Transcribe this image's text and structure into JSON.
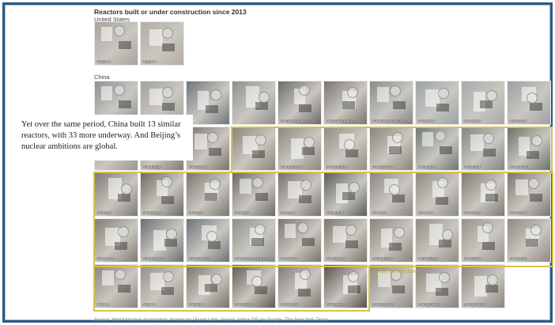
{
  "title": "Reactors built or under construction since 2013",
  "countries": {
    "us": "United States",
    "china": "China"
  },
  "callout": "Yet over the same period, China built 13 similar reactors, with 33 more underway. And Beijing’s nuclear ambitions are global.",
  "under_construction_label": "Under construction",
  "source": "Source: World Nuclear Association. Images by Planet Labs, Vexcel, Airbus DS via Google. The New York Times",
  "us_tiles": [
    {
      "label": "Vogtle 3",
      "tone": "#a9a49c"
    },
    {
      "label": "Vogtle 4",
      "tone": "#b3ada4"
    }
  ],
  "china_tiles": [
    {
      "label": "",
      "tone": "#8d9196"
    },
    {
      "label": "",
      "tone": "#a3a19b"
    },
    {
      "label": "",
      "tone": "#6f757c"
    },
    {
      "label": "",
      "tone": "#8e8f8d"
    },
    {
      "label": "Fangchenggang 4",
      "tone": "#6d6b66"
    },
    {
      "label": "Fangchenggang 3",
      "tone": "#7a7770"
    },
    {
      "label": "Shidaowan Guohe One 1",
      "tone": "#8b8a86"
    },
    {
      "label": "Tianwan 6",
      "tone": "#9ca2a6"
    },
    {
      "label": "Tianwan 5",
      "tone": "#a7aaa9"
    },
    {
      "label": "Sanmen 6",
      "tone": "#9ea1a2"
    },
    {
      "label": "",
      "tone": "#9b988f"
    },
    {
      "label": "Xiangjiang",
      "tone": "#7f7b72"
    },
    {
      "label": "Xudabao 1",
      "tone": "#7a746c"
    },
    {
      "label": "",
      "tone": "#8b8478"
    },
    {
      "label": "Zhangzhou 2",
      "tone": "#8d877d"
    },
    {
      "label": "Zhangzhou 1",
      "tone": "#938d83"
    },
    {
      "label": "Zhangzhou 3",
      "tone": "#8a8379"
    },
    {
      "label": "Haiyang 3",
      "tone": "#6f7772"
    },
    {
      "label": "Haiyang 4",
      "tone": "#7e8580"
    },
    {
      "label": "Sanaocun 1",
      "tone": "#6c7068"
    },
    {
      "label": "Lufeng 5",
      "tone": "#7c7a72"
    },
    {
      "label": "Lianjiang 2",
      "tone": "#6e6b63"
    },
    {
      "label": "Lufeng 2",
      "tone": "#7a7770"
    },
    {
      "label": "Lufeng 6",
      "tone": "#6d6a63"
    },
    {
      "label": "Lufeng 3",
      "tone": "#75726b"
    },
    {
      "label": "Haiyang 5",
      "tone": "#5c5e58"
    },
    {
      "label": "San-ao 1",
      "tone": "#8a877f"
    },
    {
      "label": "San-ao 2",
      "tone": "#8e8b82"
    },
    {
      "label": "Sanmen 5",
      "tone": "#7f7a6e"
    },
    {
      "label": "Sanmen 4",
      "tone": "#7b766c"
    },
    {
      "label": "Sanmen 3",
      "tone": "#817c72"
    },
    {
      "label": "Shidaowan 1",
      "tone": "#6a7070"
    },
    {
      "label": "Shidaowan 2",
      "tone": "#6c7478"
    },
    {
      "label": "Shidaowan Guohe One 2",
      "tone": "#8e908c"
    },
    {
      "label": "Tianwan 7",
      "tone": "#7a756b"
    },
    {
      "label": "Xudabao 2",
      "tone": "#7d766a"
    },
    {
      "label": "Taipingling 2",
      "tone": "#8a8377"
    },
    {
      "label": "Taipingling 1",
      "tone": "#938d82"
    },
    {
      "label": "Lianjiang 1",
      "tone": "#96928a"
    },
    {
      "label": "Tianwan 8",
      "tone": "#8f8a80"
    },
    {
      "label": "Xiapu 1",
      "tone": "#8a857b"
    },
    {
      "label": "Xiapu 2",
      "tone": "#938e85"
    },
    {
      "label": "Kaiping 1",
      "tone": "#7a7368"
    },
    {
      "label": "Xudabao 3",
      "tone": "#5f5b52"
    },
    {
      "label": "Xudabao 4",
      "tone": "#7e7a72"
    },
    {
      "label": "Xudabao 5",
      "tone": "#5a5048"
    },
    {
      "label": "Zhangzhou 4",
      "tone": "#8f8a82"
    },
    {
      "label": "Zhangzhou 5",
      "tone": "#86807a"
    },
    {
      "label": "Zhangzhou 6",
      "tone": "#8a847c"
    }
  ]
}
